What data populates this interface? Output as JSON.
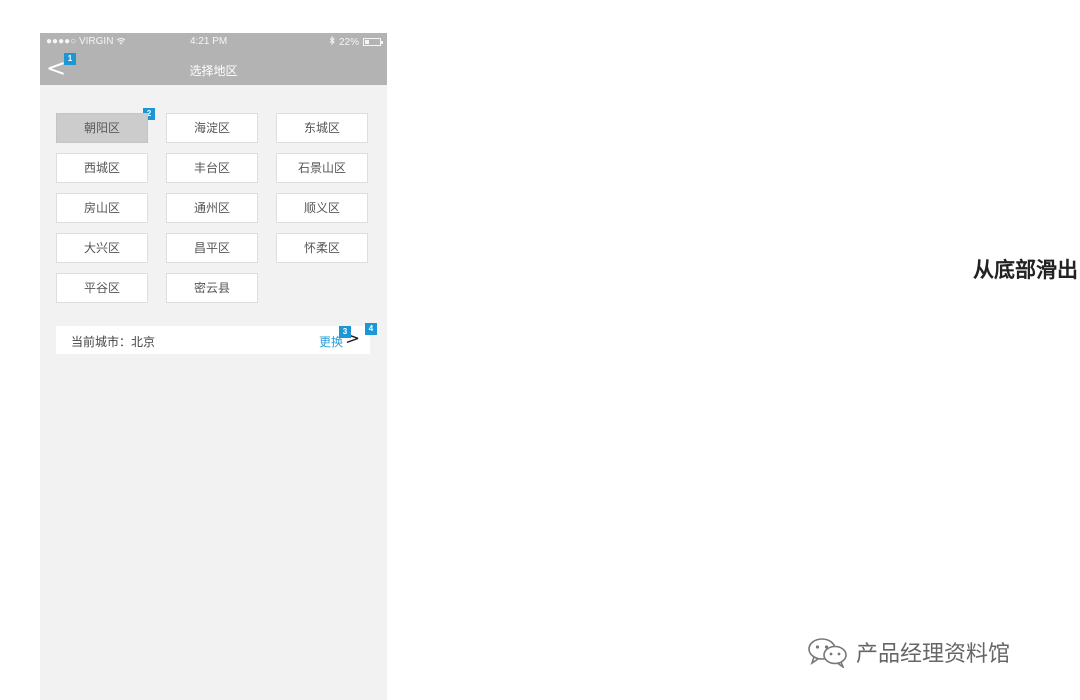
{
  "status_bar": {
    "carrier": "●●●●○ VIRGIN",
    "wifi_icon": "wifi-icon",
    "time": "4:21 PM",
    "bluetooth_icon": "bluetooth-icon",
    "battery": "22%",
    "battery_level": 0.22
  },
  "nav": {
    "back_label": "<",
    "title": "选择地区"
  },
  "badges": [
    "1",
    "2",
    "3",
    "4"
  ],
  "districts": [
    {
      "label": "朝阳区",
      "selected": true
    },
    {
      "label": "海淀区",
      "selected": false
    },
    {
      "label": "东城区",
      "selected": false
    },
    {
      "label": "西城区",
      "selected": false
    },
    {
      "label": "丰台区",
      "selected": false
    },
    {
      "label": "石景山区",
      "selected": false
    },
    {
      "label": "房山区",
      "selected": false
    },
    {
      "label": "通州区",
      "selected": false
    },
    {
      "label": "顺义区",
      "selected": false
    },
    {
      "label": "大兴区",
      "selected": false
    },
    {
      "label": "昌平区",
      "selected": false
    },
    {
      "label": "怀柔区",
      "selected": false
    },
    {
      "label": "平谷区",
      "selected": false
    },
    {
      "label": "密云县",
      "selected": false
    }
  ],
  "current_city": {
    "label": "当前城市：北京",
    "change_label": "更换",
    "arrow": ">"
  },
  "annotation": {
    "caption": "从底部滑出"
  },
  "watermark": {
    "text": "产品经理资料馆"
  },
  "colors": {
    "header_gray": "#b3b3b3",
    "badge_blue": "#1d96d6",
    "link_blue": "#2a9fd8",
    "selected_gray": "#cccccc"
  }
}
